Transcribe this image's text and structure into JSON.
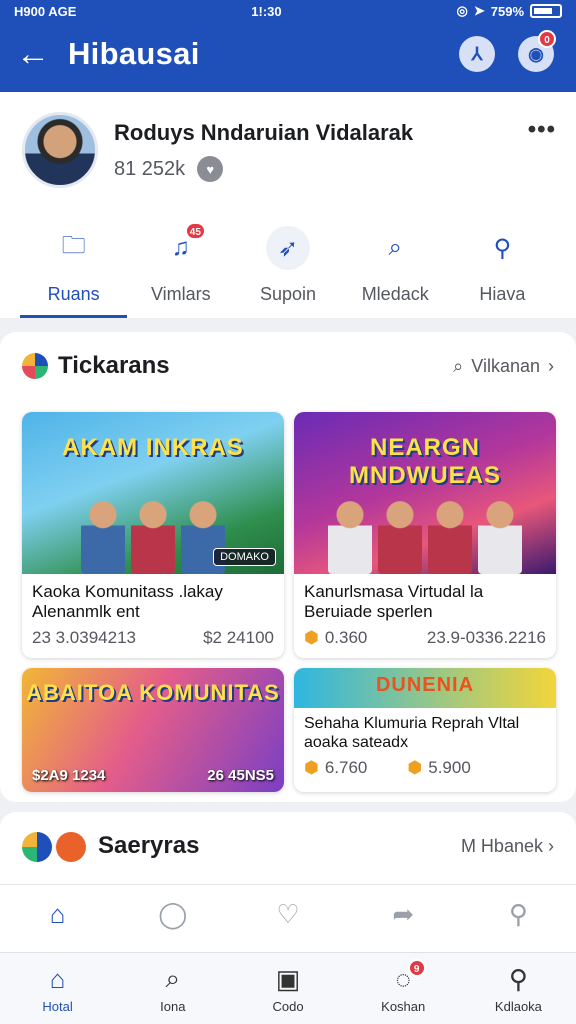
{
  "status_bar": {
    "carrier": "H900 AGE",
    "time": "1!:30",
    "battery": "759%"
  },
  "app_bar": {
    "title": "Hibausai",
    "notification_count": "0"
  },
  "profile": {
    "name": "Roduys Nndaruian Vidalarak",
    "stat": "81 252k"
  },
  "profile_tabs": [
    {
      "label": "Ruans",
      "icon": "folder-icon",
      "active": true
    },
    {
      "label": "Vimlars",
      "icon": "music-list-icon",
      "badge": "45"
    },
    {
      "label": "Supoin",
      "icon": "send-icon"
    },
    {
      "label": "Mledack",
      "icon": "search-doc-icon"
    },
    {
      "label": "Hiava",
      "icon": "user-icon"
    }
  ],
  "featured": {
    "title": "Tickarans",
    "link": "Vilkanan",
    "cards": [
      {
        "image_text": "AKAM INKRAS",
        "tag": "DOMAKO",
        "title": "Kaoka Komunitass .lakay\nAlenanmlk        ent",
        "meta_left": "23 3.0394213",
        "meta_right": "$2 24100"
      },
      {
        "image_text": "NEARGN MNDWUEAS",
        "title": "Kanurlsmasa  Virtudal        la\nBeruiade sperlen",
        "meta_left": "0.360",
        "meta_right": "23.9-0336.2216"
      },
      {
        "image_text": "ABAITOA KOMUNITAS",
        "price_left": "$2A9 1234",
        "price_right": "26 45NS5"
      },
      {
        "image_text": "DUNENIA",
        "title": "Sehaha Klumuria   Reprah Vltal\naoaka                sateadx",
        "meta_left": "6.760",
        "meta_right": "5.900"
      }
    ]
  },
  "section2": {
    "title": "Saeryras",
    "link": "M Hbanek"
  },
  "bottom_nav": [
    {
      "label": "Hotal",
      "icon": "home-icon",
      "active": true
    },
    {
      "label": "Iona",
      "icon": "search-icon"
    },
    {
      "label": "Codo",
      "icon": "profile-card-icon"
    },
    {
      "label": "Koshan",
      "icon": "chat-icon",
      "badge": "9"
    },
    {
      "label": "Kdlaoka",
      "icon": "user-icon"
    }
  ],
  "colors": {
    "primary": "#1f4fb8",
    "badge": "#e13a45",
    "coin": "#f0a020"
  }
}
